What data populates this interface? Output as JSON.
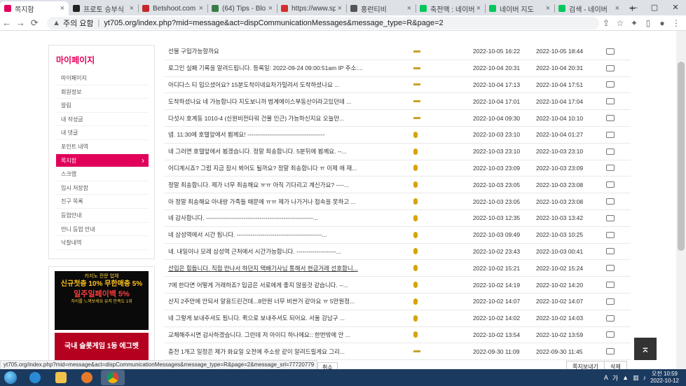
{
  "browser": {
    "tabs": [
      {
        "title": "쪽지함",
        "color": "#e1005a",
        "active": true
      },
      {
        "title": "프로토 승부식",
        "color": "#222222"
      },
      {
        "title": "Betshoot.com",
        "color": "#c62828"
      },
      {
        "title": "(64) Tips - Blo",
        "color": "#3a7d44"
      },
      {
        "title": "https://www.sp",
        "color": "#d32f2f"
      },
      {
        "title": "홍런티비",
        "color": "#555555"
      },
      {
        "title": "축전액 : 네이버",
        "color": "#03c75a"
      },
      {
        "title": "네이버 지도",
        "color": "#03c75a"
      },
      {
        "title": "검색 - 네이버",
        "color": "#03c75a"
      }
    ],
    "new_tab": "+",
    "address": {
      "warning": "주의 요함",
      "url": "yt705.org/index.php?mid=message&act=dispCommunicationMessages&message_type=R&page=2"
    },
    "status_url": "yt705.org/index.php?mid=message&act=dispCommunicationMessages&message_type=R&page=2&message_srl=77720779"
  },
  "sidebar": {
    "title": "마이페이지",
    "items": [
      {
        "label": "마이페이지"
      },
      {
        "label": "회원정보"
      },
      {
        "label": "알림"
      },
      {
        "label": "내 작성글"
      },
      {
        "label": "내 댓글"
      },
      {
        "label": "포인트 내역"
      },
      {
        "label": "쪽지함",
        "active": true
      },
      {
        "label": "스크랩"
      },
      {
        "label": "임시 저장함"
      },
      {
        "label": "친구 목록"
      },
      {
        "label": "등업안내"
      },
      {
        "label": "언니 등업 안내"
      },
      {
        "label": "낙찰내역"
      }
    ]
  },
  "banners": {
    "b1_top": "카지노 전문 업체",
    "b1_main": "신규첫충 10% 무한매충 5%",
    "b1_sub": "일주일페이백 5%",
    "b1_small": "차이를 느껴보세요 유저 만족도 1위",
    "b2_line": "국내 슬롯게임 1등 에그벳"
  },
  "messages": [
    {
      "title": "선불 구입가능할까요",
      "sent": "2022-10-05 16:22",
      "read": "2022-10-05 18:44",
      "icon": "bar"
    },
    {
      "title": "로그인 실패 기록을 알려드립니다. 등록일: 2022-09-24 09:00:51am IP 주소:...",
      "sent": "2022-10-04 20:31",
      "read": "2022-10-04 20:31",
      "icon": "bar"
    },
    {
      "title": "아디다스 티 입으셨어요? 15분도착이네요차가밀려서 도착하셨나요 ...",
      "sent": "2022-10-04 17:13",
      "read": "2022-10-04 17:51",
      "icon": "bar"
    },
    {
      "title": "도착하셨나요 네 가능합니다 지도보니까 범계에이스부동산이라고있던데 ...",
      "sent": "2022-10-04 17:01",
      "read": "2022-10-04 17:04",
      "icon": "bar"
    },
    {
      "title": "다섯시 호계동 1010-4 (신원비전타워 건물 인근) 가능하신지요 오늘만...",
      "sent": "2022-10-04 09:30",
      "read": "2022-10-04 10:10",
      "icon": "bar"
    },
    {
      "title": "넵. 11:30에 호텔앞에서 뵙께요! ---------------------------------------",
      "sent": "2022-10-03 23:10",
      "read": "2022-10-04 01:27",
      "icon": "coin"
    },
    {
      "title": "네 그러면 호텔앞에서 뵙겠습니다. 정말 죄송합니다. 5분뒤에 뵙께요. --...",
      "sent": "2022-10-03 23:10",
      "read": "2022-10-03 23:10",
      "icon": "coin"
    },
    {
      "title": "어디계시죠? 그럼 지금 잠시 뵈어도 될까요? 정말 죄송합니다 ㅠ 이제 애 재...",
      "sent": "2022-10-03 23:09",
      "read": "2022-10-03 23:09",
      "icon": "coin"
    },
    {
      "title": "정말 죄송합니다. 제가 너무 죄송해요 ㅠㅠ 아직 기다리고 계신가요? ----...",
      "sent": "2022-10-03 23:05",
      "read": "2022-10-03 23:08",
      "icon": "coin"
    },
    {
      "title": "아 정말 죄송해요 아내랑 가족들 때문에 ㅠㅠ 제가 나가거나 접속을 못하고 ...",
      "sent": "2022-10-03 23:05",
      "read": "2022-10-03 23:08",
      "icon": "coin"
    },
    {
      "title": "네 감사합니다. ------------------------------------------------------...",
      "sent": "2022-10-03 12:35",
      "read": "2022-10-03 13:42",
      "icon": "coin"
    },
    {
      "title": "네 삼성역에서 시간 됩니다. -------------------------------------------...",
      "sent": "2022-10-03 09:49",
      "read": "2022-10-03 10:25",
      "icon": "coin"
    },
    {
      "title": "네. 내일이나 모레 삼성역 근처에서 시간가능합니다. --------------------...",
      "sent": "2022-10-02 23:43",
      "read": "2022-10-03 00:41",
      "icon": "coin"
    },
    {
      "title": "선입은 힘듭니다. 직접 만나서 하던지 택배기사님 통해서 현금거래 선호합니...",
      "sent": "2022-10-02 15:21",
      "read": "2022-10-02 15:24",
      "icon": "coin",
      "underline": true
    },
    {
      "title": "7에 한다면 어떻게 거래하죠? 입금은 서로에게 좋지 않을것 같습니다. --...",
      "sent": "2022-10-02 14:19",
      "read": "2022-10-02 14:20",
      "icon": "coin"
    },
    {
      "title": "산지 2주만에 안되서 알용드린건데...8만원 너무 비싼거 같아요 ㅠ 5만원정...",
      "sent": "2022-10-02 14:07",
      "read": "2022-10-02 14:07",
      "icon": "coin"
    },
    {
      "title": "네 그렇게 보내주셔도 됩니다. 퀵으로 보내주셔도 되어요. 서울 강남구 ...",
      "sent": "2022-10-02 14:02",
      "read": "2022-10-02 14:03",
      "icon": "coin"
    },
    {
      "title": "교체해주시면 감사하겠습니다. 그런데 저 아이디 하나에요:: 한번밖에 안 ...",
      "sent": "2022-10-02 13:54",
      "read": "2022-10-02 13:59",
      "icon": "coin"
    },
    {
      "title": "충전 1개고 일정은 제가 화요일 오전에 주소랑 같이 알려드릴게요 그리...",
      "sent": "2022-09-30 11:09",
      "read": "2022-09-30 11:45",
      "icon": "bar"
    }
  ],
  "actions": {
    "cancel": "취소",
    "view_selected": "쪽지보내기",
    "delete": "삭제",
    "totop": "⌅"
  },
  "taskbar": {
    "time": "오전 10:59",
    "date": "2022-10-12",
    "ime": "가",
    "lang": "A"
  }
}
